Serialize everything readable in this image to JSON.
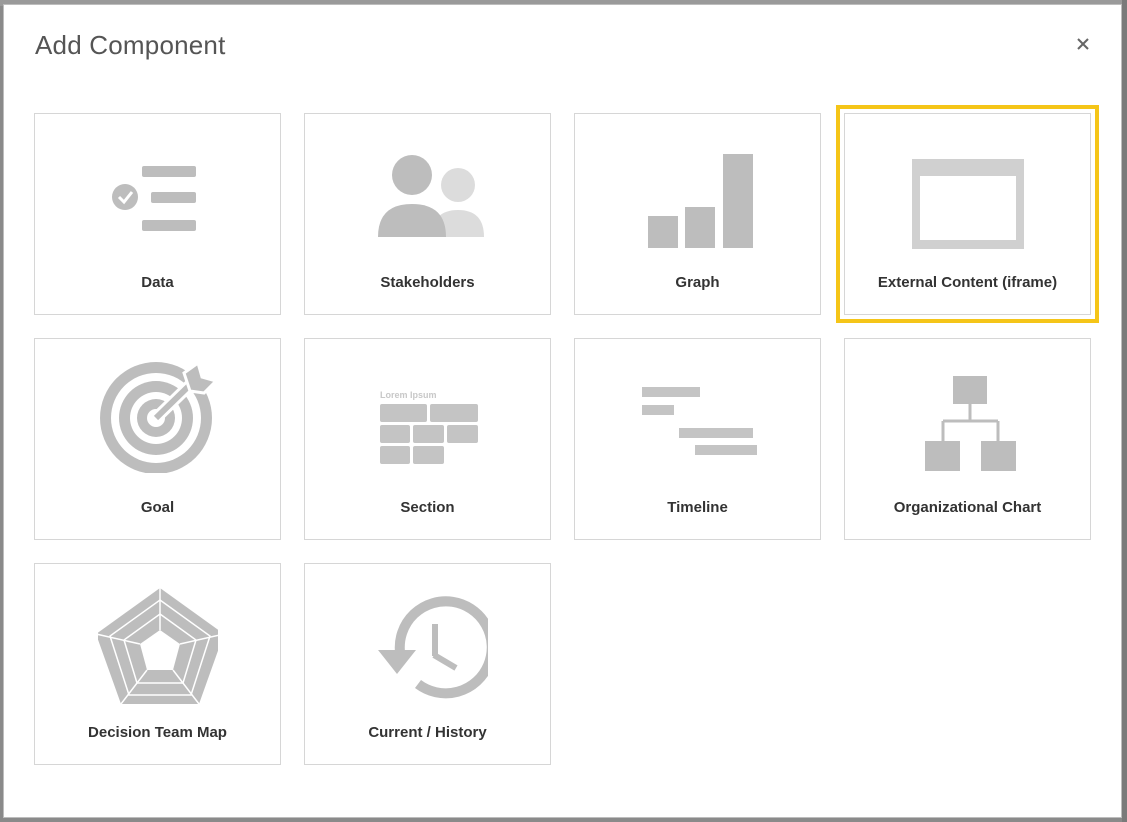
{
  "dialog": {
    "title": "Add Component",
    "close_label": "×"
  },
  "components": [
    {
      "label": "Data",
      "icon": "checklist-icon",
      "selected": false
    },
    {
      "label": "Stakeholders",
      "icon": "people-icon",
      "selected": false
    },
    {
      "label": "Graph",
      "icon": "bar-graph-icon",
      "selected": false
    },
    {
      "label": "External Content (iframe)",
      "icon": "iframe-window-icon",
      "selected": true
    },
    {
      "label": "Goal",
      "icon": "target-icon",
      "selected": false
    },
    {
      "label": "Section",
      "icon": "section-grid-icon",
      "selected": false,
      "icon_text": "Lorem Ipsum"
    },
    {
      "label": "Timeline",
      "icon": "gantt-timeline-icon",
      "selected": false
    },
    {
      "label": "Organizational Chart",
      "icon": "org-chart-icon",
      "selected": false
    },
    {
      "label": "Decision Team Map",
      "icon": "radar-pentagon-icon",
      "selected": false
    },
    {
      "label": "Current / History",
      "icon": "history-clock-icon",
      "selected": false
    }
  ],
  "colors": {
    "icon_gray": "#bdbdbd",
    "icon_light": "#dcdcdc",
    "selected_outline": "#f5c518",
    "label": "#333333",
    "title": "#555555"
  }
}
